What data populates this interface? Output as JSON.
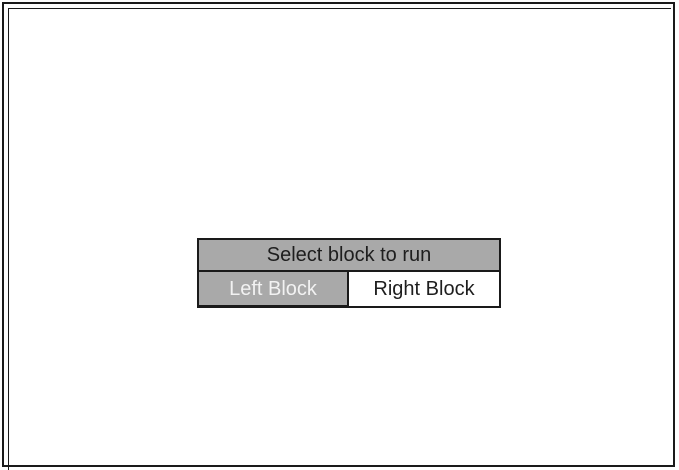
{
  "dialog": {
    "title": "Select block to run",
    "buttons": {
      "left_label": "Left Block",
      "right_label": "Right  Block"
    }
  },
  "colors": {
    "title_bg": "#a9a9a9",
    "selected_bg": "#a9a9a9",
    "selected_text": "#f2f2f2",
    "unselected_bg": "#ffffff",
    "border": "#1a1a1a"
  }
}
